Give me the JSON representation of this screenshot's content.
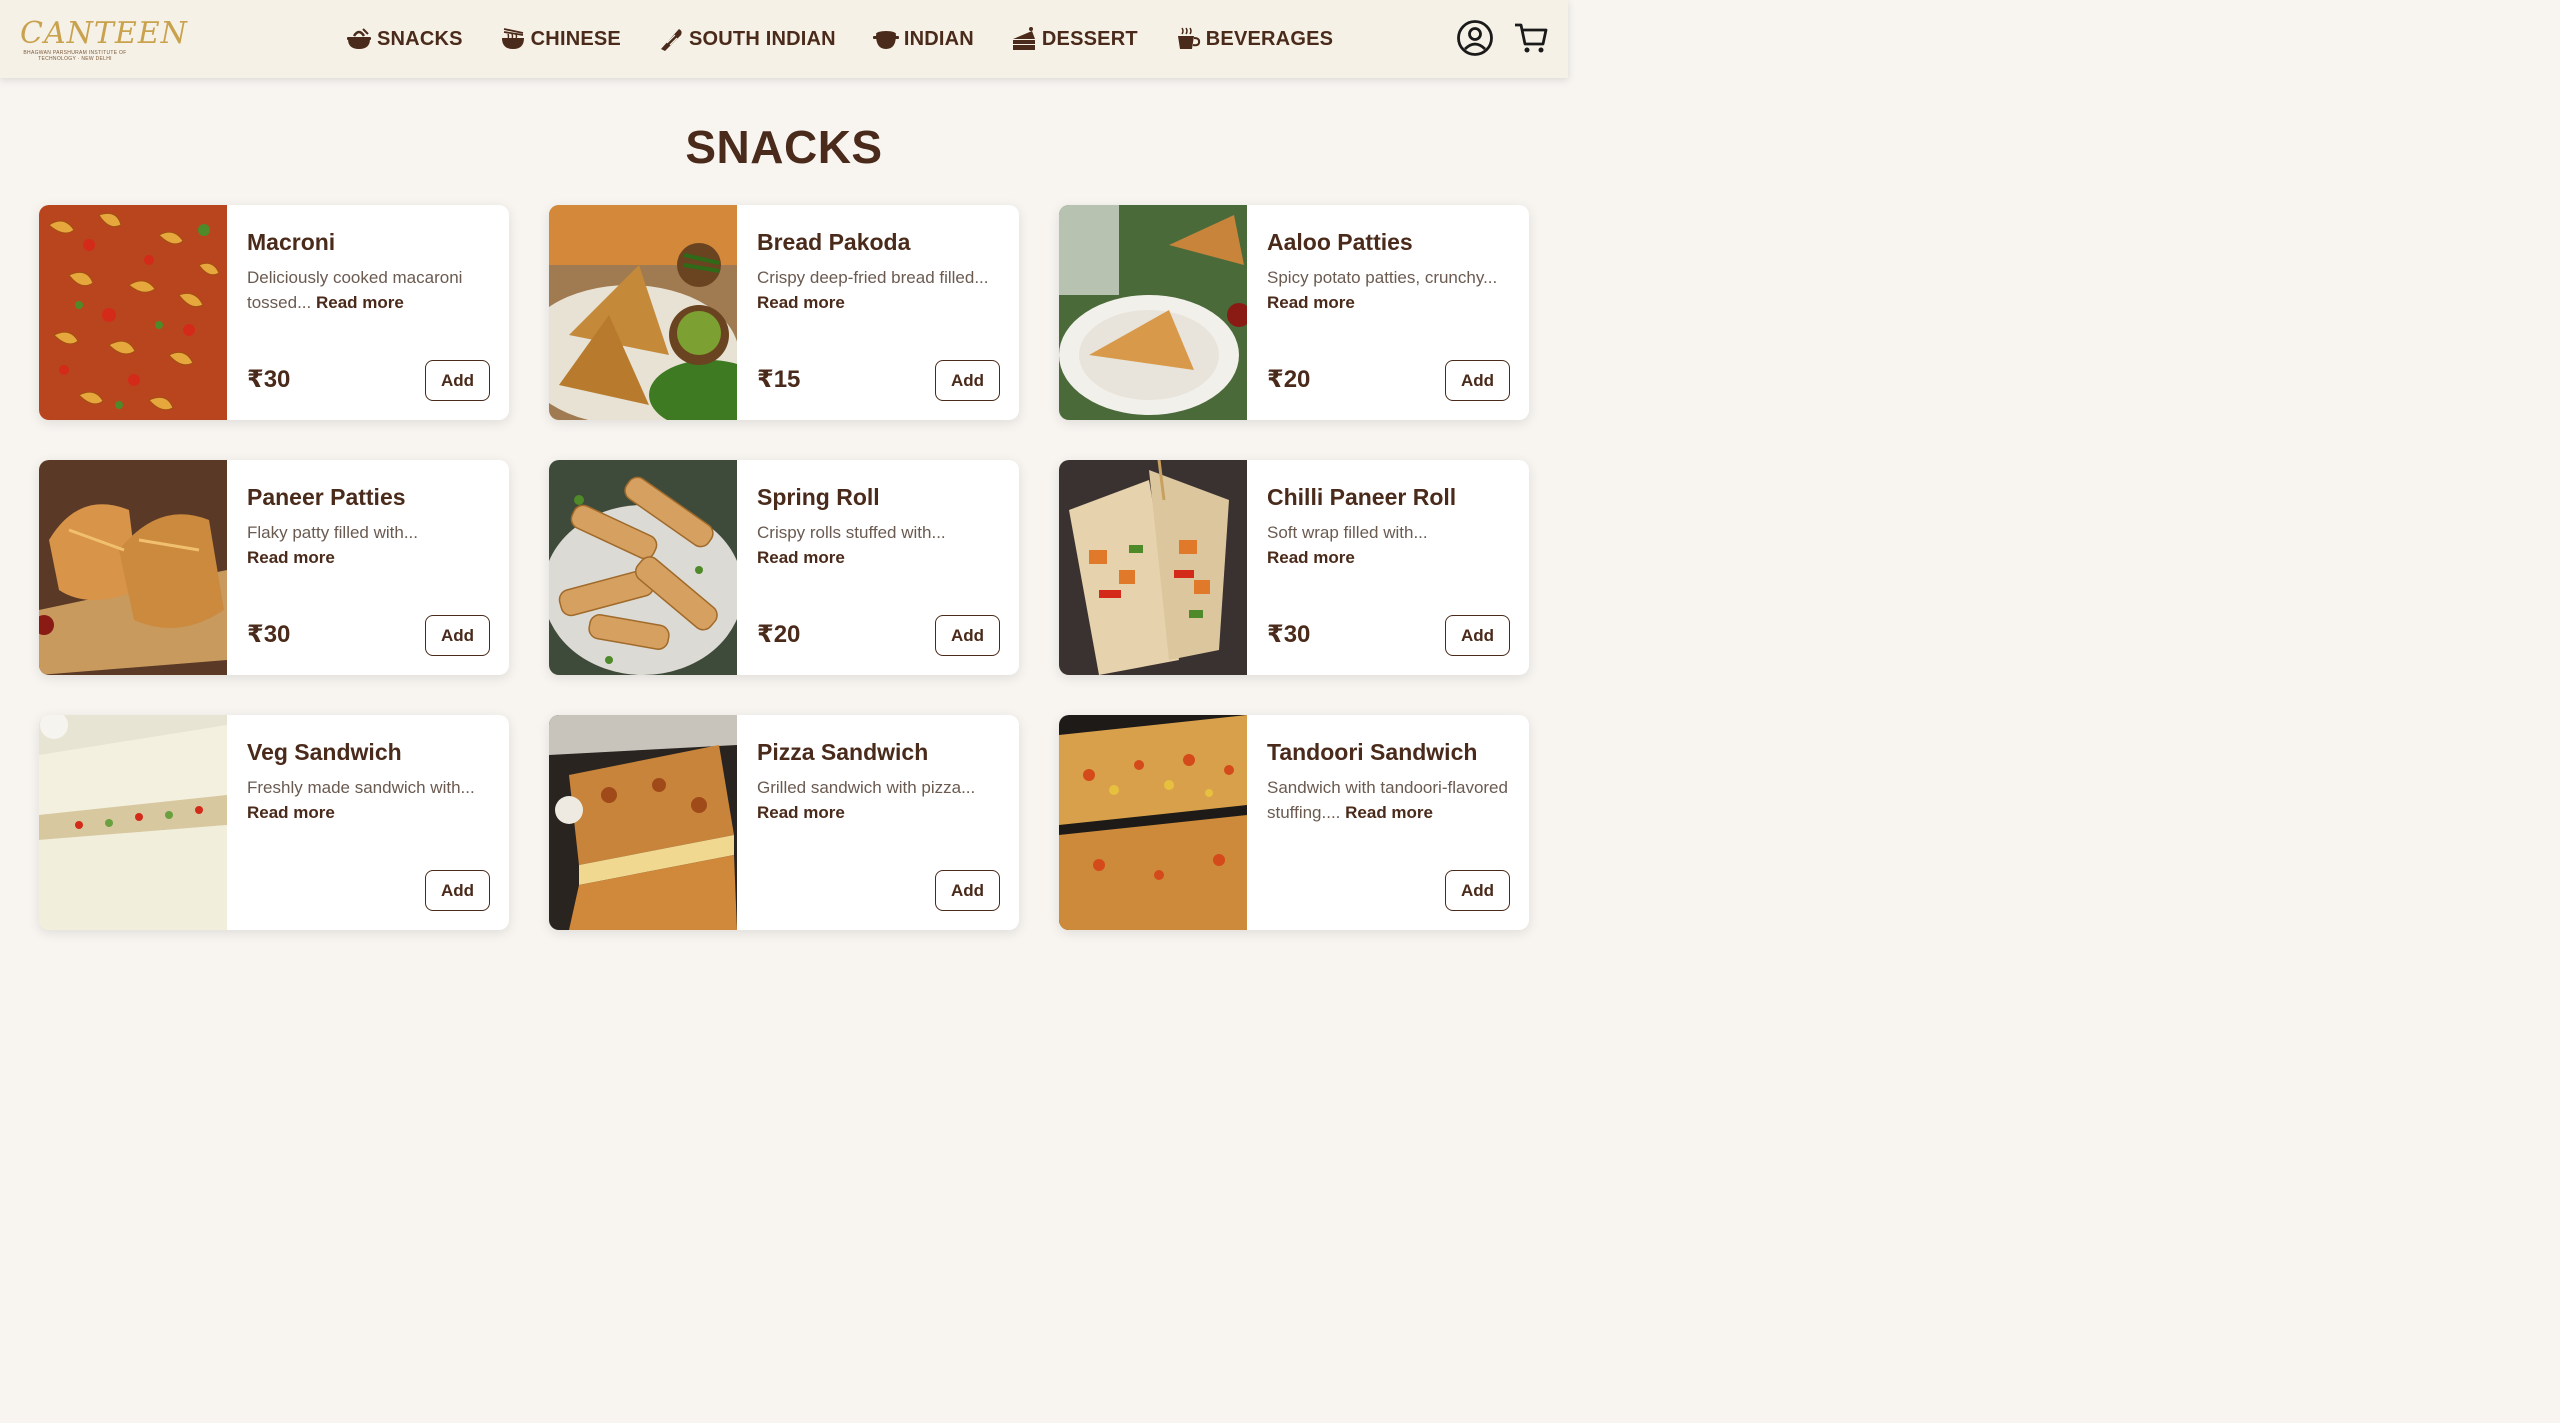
{
  "brand": {
    "logo_word": "CANTEEN",
    "logo_sub": "BHAGWAN PARSHURAM INSTITUTE OF TECHNOLOGY · NEW DELHI"
  },
  "nav": {
    "items": [
      {
        "label": "SNACKS",
        "icon": "snack-icon"
      },
      {
        "label": "CHINESE",
        "icon": "noodle-bowl-icon"
      },
      {
        "label": "SOUTH INDIAN",
        "icon": "dosa-icon"
      },
      {
        "label": "INDIAN",
        "icon": "pot-icon"
      },
      {
        "label": "DESSERT",
        "icon": "cake-icon"
      },
      {
        "label": "BEVERAGES",
        "icon": "cup-icon"
      }
    ],
    "right_icons": [
      "user-icon",
      "cart-icon"
    ]
  },
  "page": {
    "title": "SNACKS"
  },
  "read_more_label": "Read more",
  "add_label": "Add",
  "products": [
    {
      "name": "Macroni",
      "desc": "Deliciously cooked macaroni tossed...",
      "price": "₹30",
      "img": "macaroni"
    },
    {
      "name": "Bread Pakoda",
      "desc": "Crispy deep-fried bread filled...",
      "price": "₹15",
      "img": "bread-pakoda"
    },
    {
      "name": "Aaloo Patties",
      "desc": "Spicy potato patties, crunchy...",
      "price": "₹20",
      "img": "aaloo-patties"
    },
    {
      "name": "Paneer Patties",
      "desc": "Flaky patty filled with...",
      "price": "₹30",
      "img": "paneer-patties"
    },
    {
      "name": "Spring Roll",
      "desc": "Crispy rolls stuffed with...",
      "price": "₹20",
      "img": "spring-roll"
    },
    {
      "name": "Chilli Paneer Roll",
      "desc": "Soft wrap filled with...",
      "price": "₹30",
      "img": "chilli-paneer-roll"
    },
    {
      "name": "Veg Sandwich",
      "desc": "Freshly made sandwich with...",
      "price": "",
      "img": "veg-sandwich"
    },
    {
      "name": "Pizza Sandwich",
      "desc": "Grilled sandwich with pizza...",
      "price": "",
      "img": "pizza-sandwich"
    },
    {
      "name": "Tandoori Sandwich",
      "desc": "Sandwich with tandoori-flavored stuffing....",
      "price": "",
      "img": "tandoori-sandwich"
    }
  ],
  "colors": {
    "accent": "#4a2a1a",
    "navbar_bg": "#f6f1e6",
    "page_bg": "#f8f5f1",
    "logo_gold": "#c9a24e"
  }
}
